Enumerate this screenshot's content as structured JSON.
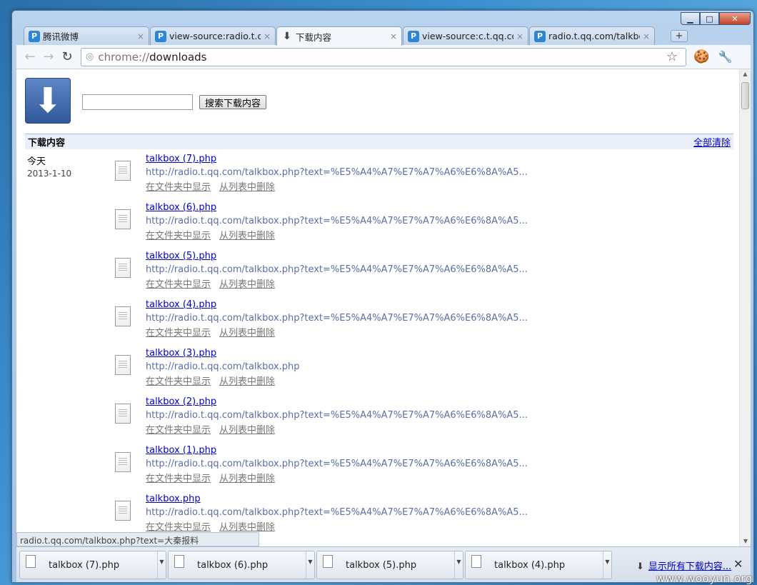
{
  "window": {
    "controls": {
      "minimize": "▁",
      "maximize": "□",
      "close": "✕"
    }
  },
  "tabs": [
    {
      "title": "腾讯微博",
      "favicon": "P",
      "active": false
    },
    {
      "title": "view-source:radio.t.qq",
      "favicon": "P",
      "active": false
    },
    {
      "title": "下载内容",
      "favicon": "⬇",
      "active": true
    },
    {
      "title": "view-source:c.t.qq.con",
      "favicon": "P",
      "active": false
    },
    {
      "title": "radio.t.qq.com/talkbo",
      "favicon": "P",
      "active": false
    }
  ],
  "tab_close_glyph": "×",
  "new_tab_glyph": "+",
  "toolbar": {
    "back": "←",
    "forward": "→",
    "reload": "↻",
    "url_scheme": "chrome://",
    "url_rest": "downloads",
    "page_icon": "◎",
    "star": "☆",
    "cookie": "🍪",
    "wrench": "🔧"
  },
  "page": {
    "logo_glyph": "⬇",
    "search_button": "搜索下载内容",
    "search_value": "",
    "header_title": "下载内容",
    "clear_all": "全部清除",
    "day_label": "今天",
    "date": "2013-1-10",
    "show_in_folder": "在文件夹中显示",
    "remove_from_list": "从列表中删除",
    "downloads": [
      {
        "name": "talkbox (7).php",
        "url": "http://radio.t.qq.com/talkbox.php?text=%E5%A4%A7%E7%A7%A6%E6%8A%A5..."
      },
      {
        "name": "talkbox (6).php",
        "url": "http://radio.t.qq.com/talkbox.php?text=%E5%A4%A7%E7%A7%A6%E6%8A%A5..."
      },
      {
        "name": "talkbox (5).php",
        "url": "http://radio.t.qq.com/talkbox.php?text=%E5%A4%A7%E7%A7%A6%E6%8A%A5..."
      },
      {
        "name": "talkbox (4).php",
        "url": "http://radio.t.qq.com/talkbox.php?text=%E5%A4%A7%E7%A7%A6%E6%8A%A5..."
      },
      {
        "name": "talkbox (3).php",
        "url": "http://radio.t.qq.com/talkbox.php"
      },
      {
        "name": "talkbox (2).php",
        "url": "http://radio.t.qq.com/talkbox.php?text=%E5%A4%A7%E7%A7%A6%E6%8A%A5..."
      },
      {
        "name": "talkbox (1).php",
        "url": "http://radio.t.qq.com/talkbox.php?text=%E5%A4%A7%E7%A7%A6%E6%8A%A5..."
      },
      {
        "name": "talkbox.php",
        "url": "http://radio.t.qq.com/talkbox.php?text=%E5%A4%A7%E7%A7%A6%E6%8A%A5..."
      }
    ]
  },
  "status_bubble": "radio.t.qq.com/talkbox.php?text=大秦报料",
  "scrollbar": {
    "up": "▲",
    "down": "▼"
  },
  "shelf": {
    "items": [
      "talkbox (7).php",
      "talkbox (6).php",
      "talkbox (5).php",
      "talkbox (4).php"
    ],
    "dropdown_glyph": "▼",
    "show_all_arrow": "⬇",
    "show_all": "显示所有下载内容...",
    "close": "✕"
  },
  "watermark": "www.wooyun.org"
}
